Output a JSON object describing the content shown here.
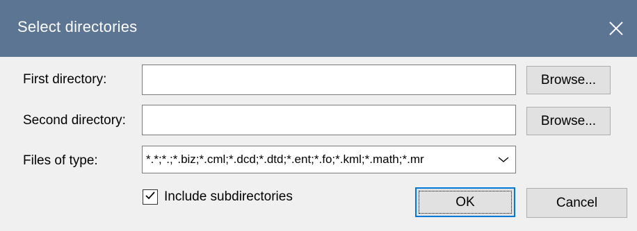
{
  "window": {
    "title": "Select directories",
    "close_icon": "close-icon"
  },
  "first_directory": {
    "label": "First directory:",
    "value": "",
    "browse_label": "Browse..."
  },
  "second_directory": {
    "label": "Second directory:",
    "value": "",
    "browse_label": "Browse..."
  },
  "files_of_type": {
    "label": "Files of type:",
    "selected": "*.*;*.;*.biz;*.cml;*.dcd;*.dtd;*.ent;*.fo;*.kml;*.math;*.mr",
    "arrow_icon": "chevron-down-icon"
  },
  "include_subdirectories": {
    "label": "Include subdirectories",
    "checked": true
  },
  "buttons": {
    "ok_label": "OK",
    "cancel_label": "Cancel"
  },
  "colors": {
    "titlebar": "#5b7593",
    "background": "#f0f0f0",
    "default_button_border": "#0078d7"
  }
}
